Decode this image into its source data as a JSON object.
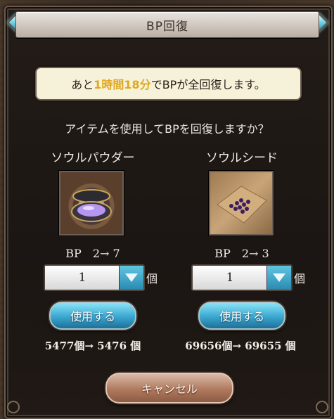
{
  "dialog": {
    "title": "BP回復",
    "notice": {
      "prefix": "あと",
      "time": "1時間18分",
      "suffix": "でBPが全回復します。"
    },
    "question": "アイテムを使用してBPを回復しますか？",
    "cancel_label": "キャンセル"
  },
  "items": [
    {
      "name": "ソウルパウダー",
      "icon": "soul-powder-icon",
      "bp_text": "BP　2→ 7",
      "quantity": "1",
      "unit": "個",
      "use_label": "使用する",
      "count_text": "5477個→ 5476 個"
    },
    {
      "name": "ソウルシード",
      "icon": "soul-seed-icon",
      "bp_text": "BP　2→ 3",
      "quantity": "1",
      "unit": "個",
      "use_label": "使用する",
      "count_text": "69656個→ 69655 個"
    }
  ],
  "colors": {
    "highlight": "#e0a81d",
    "use_button": "#3aa7cf",
    "cancel_button": "#b07a5e"
  }
}
